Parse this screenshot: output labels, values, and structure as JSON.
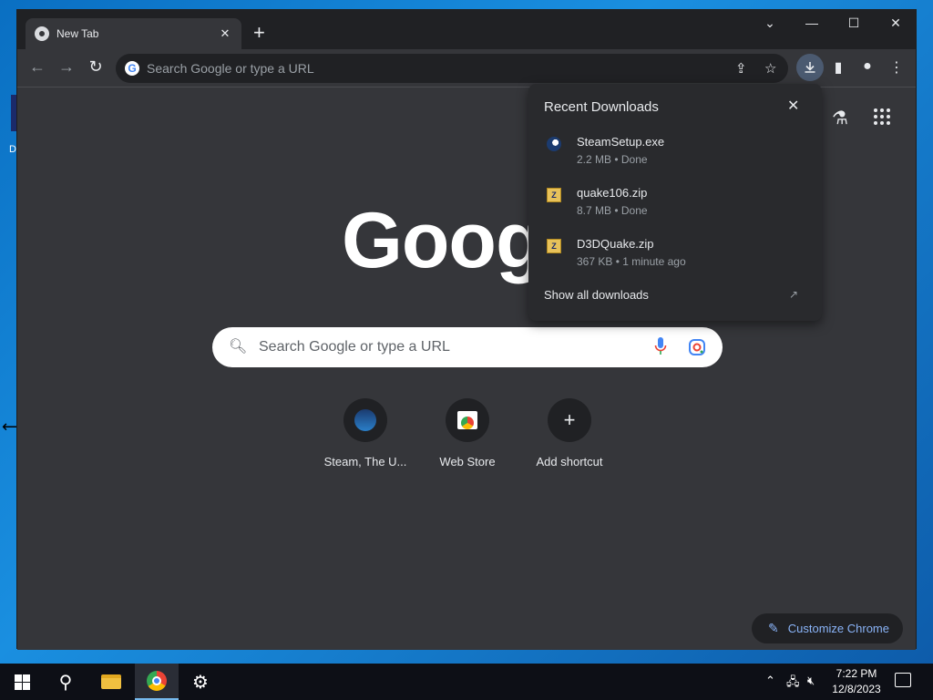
{
  "desktop": {
    "icon_label": "D"
  },
  "browser": {
    "tab": {
      "title": "New Tab"
    },
    "window_controls": {
      "dropdown": "⌄",
      "minimize": "—",
      "maximize": "☐",
      "close": "✕"
    },
    "omnibox": {
      "placeholder": "Search Google or type a URL"
    }
  },
  "ntp": {
    "logo_text": "Goog",
    "search": {
      "placeholder": "Search Google or type a URL"
    },
    "shortcuts": [
      {
        "label": "Steam, The U..."
      },
      {
        "label": "Web Store"
      },
      {
        "label": "Add shortcut"
      }
    ],
    "customize_label": "Customize Chrome"
  },
  "downloads": {
    "title": "Recent Downloads",
    "items": [
      {
        "name": "SteamSetup.exe",
        "status": "2.2 MB • Done",
        "icon": "steam-icon"
      },
      {
        "name": "quake106.zip",
        "status": "8.7 MB • Done",
        "icon": "zip-icon"
      },
      {
        "name": "D3DQuake.zip",
        "status": "367 KB • 1 minute ago",
        "icon": "zip-icon"
      }
    ],
    "show_all": "Show all downloads"
  },
  "taskbar": {
    "time": "7:22 PM",
    "date": "12/8/2023"
  },
  "colors": {
    "accent": "#8ab4f8",
    "background": "#35363a",
    "titlebar": "#202124"
  }
}
